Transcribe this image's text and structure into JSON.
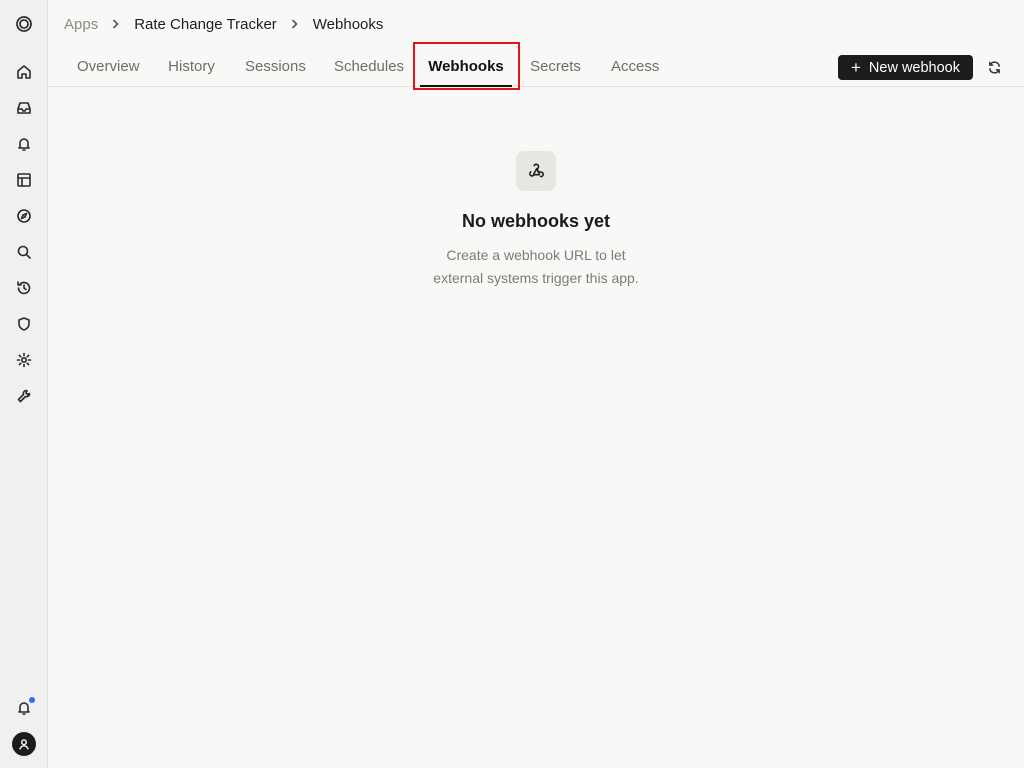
{
  "app_title": "Rate Change Tracker - Webhooks",
  "sidebar": {
    "items": [
      {
        "icon": "home-icon",
        "label": "Home"
      },
      {
        "icon": "inbox-icon",
        "label": "Inbox"
      },
      {
        "icon": "bell-icon",
        "label": "Notifications"
      },
      {
        "icon": "layout-icon",
        "label": "Apps"
      },
      {
        "icon": "compass-icon",
        "label": "Explore"
      },
      {
        "icon": "search-icon",
        "label": "Search"
      },
      {
        "icon": "history-icon",
        "label": "History"
      },
      {
        "icon": "shield-icon",
        "label": "Security"
      },
      {
        "icon": "gear-icon",
        "label": "Settings"
      },
      {
        "icon": "wrench-icon",
        "label": "Tools"
      }
    ],
    "bottom": {
      "notifications_icon": "bell-icon",
      "has_unread": true,
      "avatar_icon": "user-icon"
    },
    "accent_color": "#2f6bff"
  },
  "breadcrumb": {
    "items": [
      "Apps",
      "Rate Change Tracker",
      "Webhooks"
    ]
  },
  "tabs": [
    {
      "label": "Overview",
      "active": false
    },
    {
      "label": "History",
      "active": false
    },
    {
      "label": "Sessions",
      "active": false
    },
    {
      "label": "Schedules",
      "active": false
    },
    {
      "label": "Webhooks",
      "active": true
    },
    {
      "label": "Secrets",
      "active": false
    },
    {
      "label": "Access",
      "active": false
    }
  ],
  "actions": {
    "new_webhook_label": "New webhook",
    "new_webhook_icon": "plus-icon",
    "refresh_icon": "refresh-icon"
  },
  "empty_state": {
    "icon": "webhook-icon",
    "title": "No webhooks yet",
    "description_line1": "Create a webhook URL to let",
    "description_line2": "external systems trigger this app."
  },
  "colors": {
    "highlight": "#e0151b",
    "primary_button": "#1c1c1c"
  }
}
